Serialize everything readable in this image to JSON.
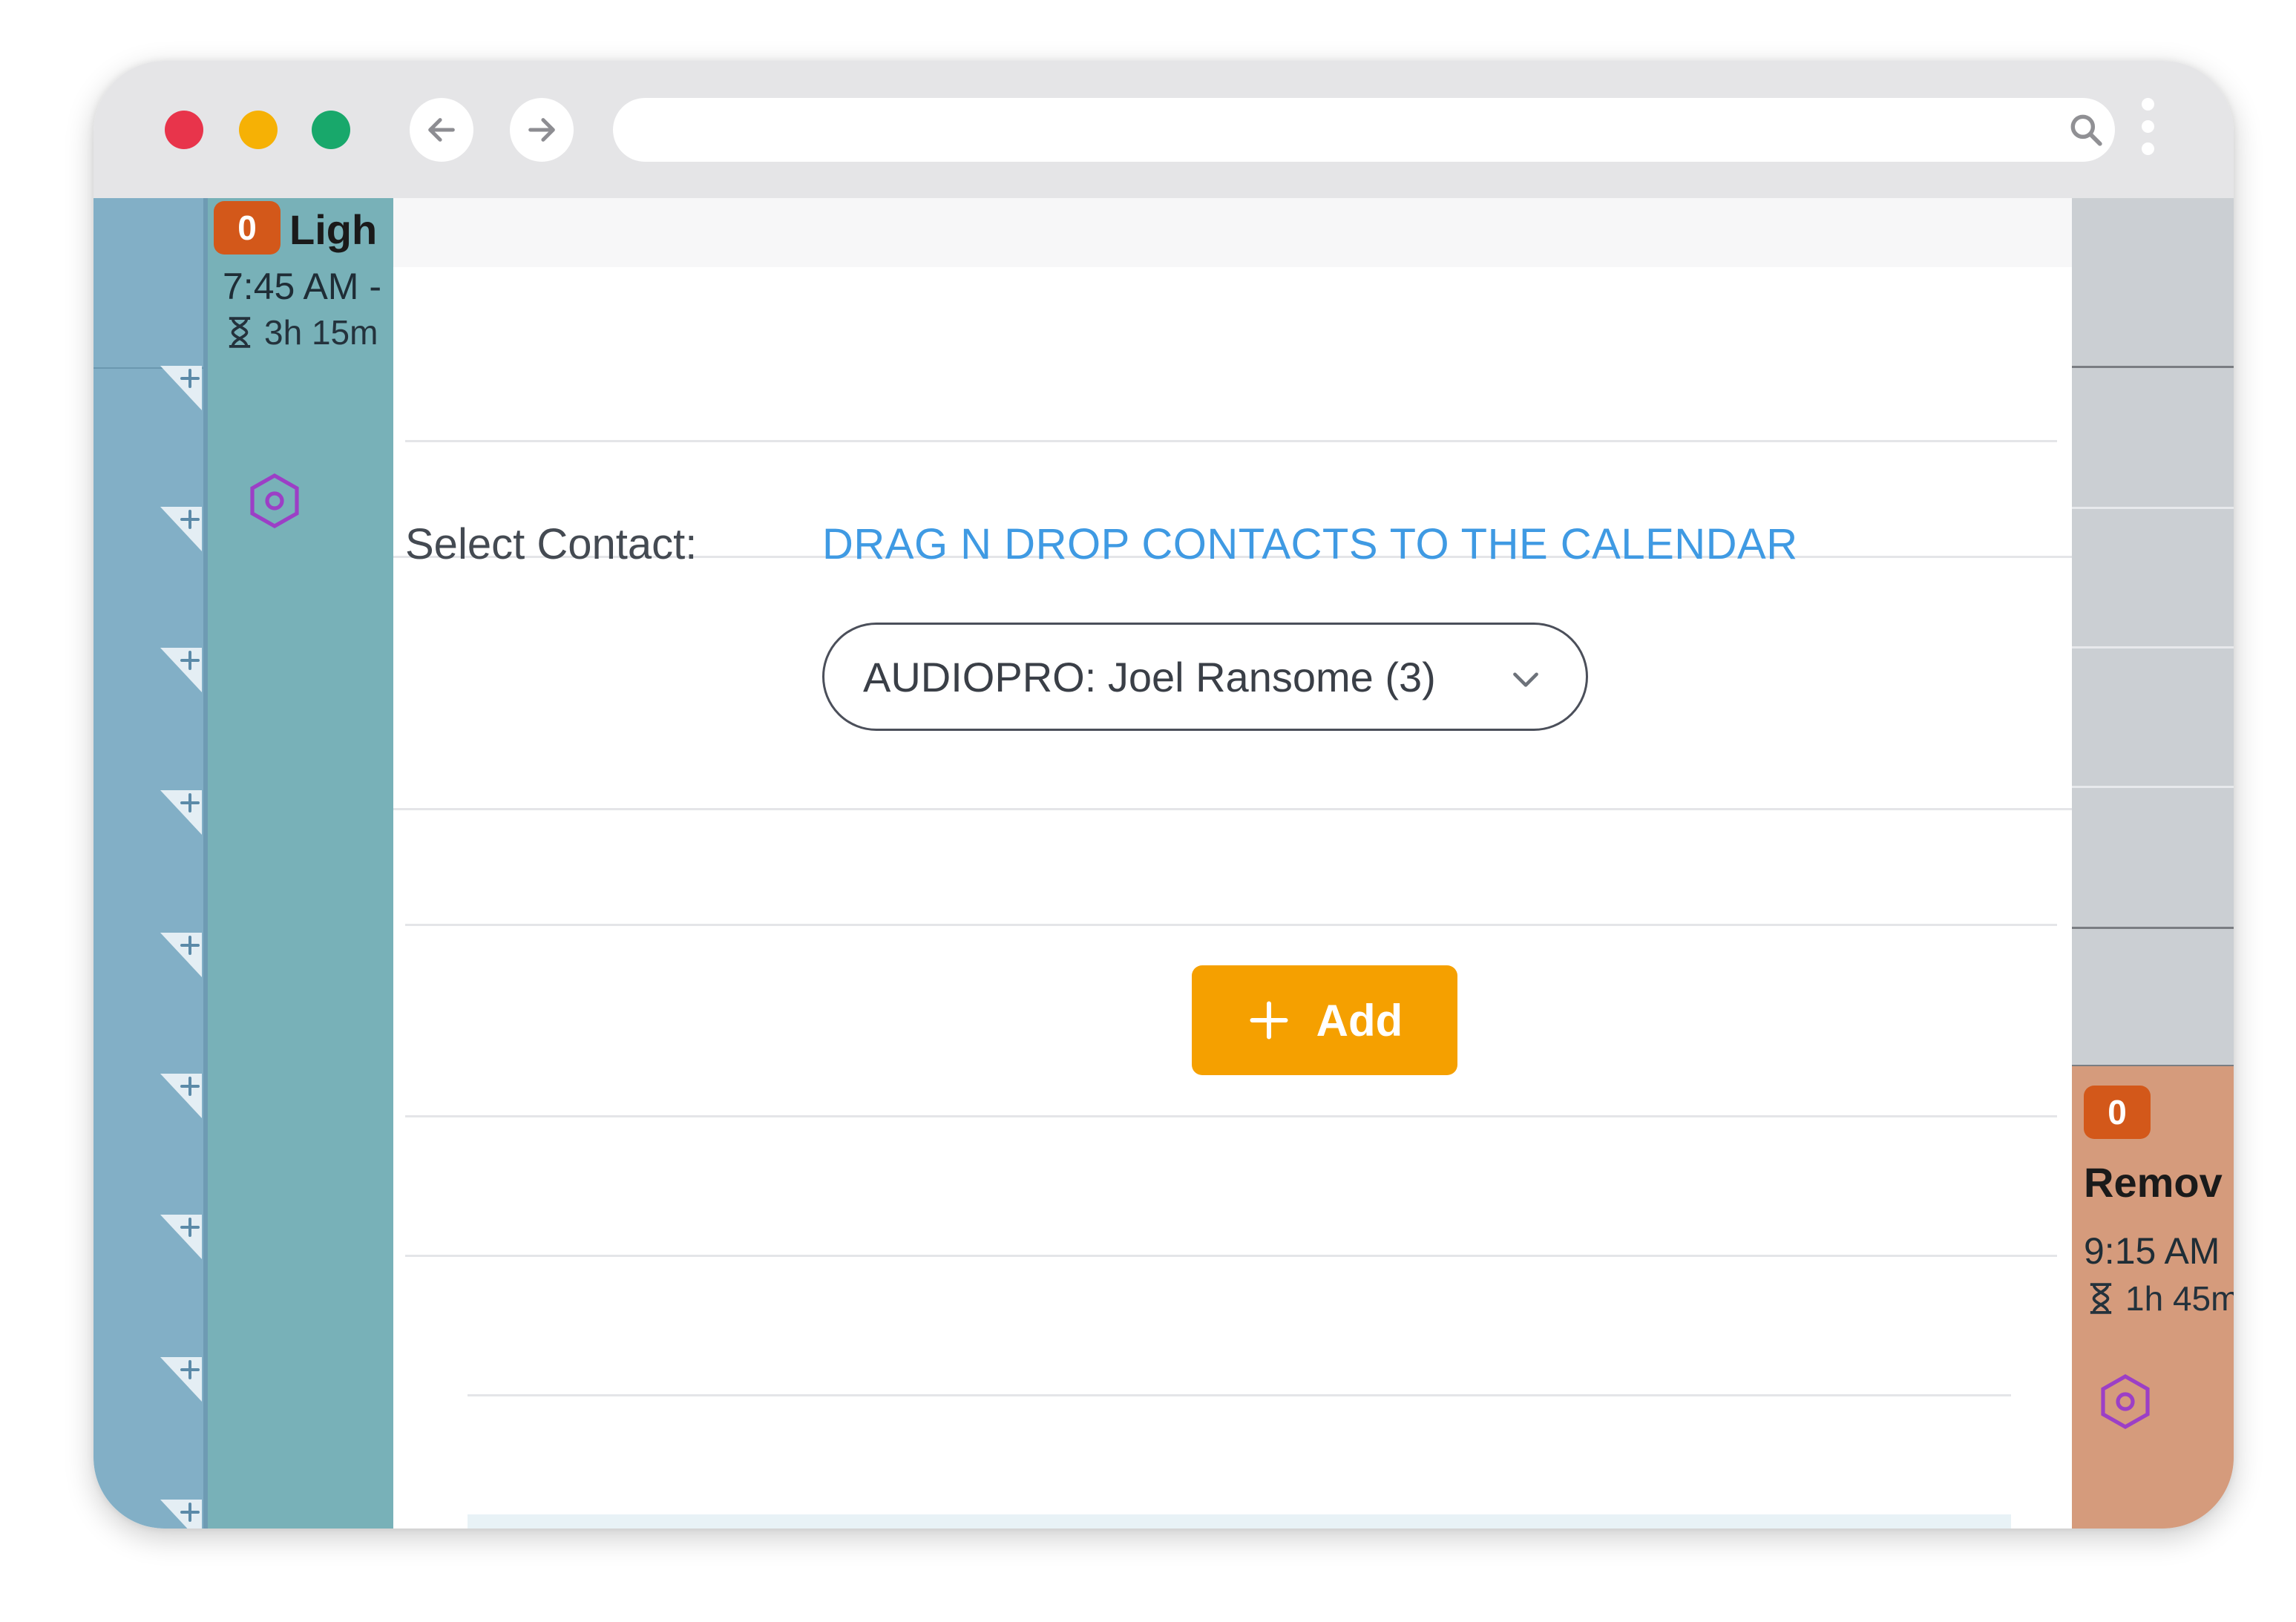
{
  "browser": {
    "address_url": "",
    "icons": {
      "back": "arrow-left-icon",
      "forward": "arrow-right-icon",
      "search": "search-icon",
      "menu": "kebab-menu-icon"
    }
  },
  "calendar": {
    "left_event": {
      "badge": "0",
      "title": "Ligh",
      "time": "7:45 AM -",
      "duration": "3h 15m",
      "color": "#78b1b8"
    },
    "right_event": {
      "badge": "0",
      "title": "Remov",
      "time": "9:15 AM",
      "duration": "1h 45m",
      "color": "#d59b7c"
    }
  },
  "modal": {
    "select_contact_label": "Select Contact:",
    "drag_hint": "DRAG N DROP CONTACTS TO THE CALENDAR",
    "contact_select_value": "AUDIOPRO: Joel Ransome (3)",
    "add_button_label": "Add"
  },
  "colors": {
    "accent_orange": "#f5a000",
    "link_blue": "#3f9ae3",
    "badge_orange": "#d3581a",
    "icon_purple": "#9c3fc6"
  }
}
